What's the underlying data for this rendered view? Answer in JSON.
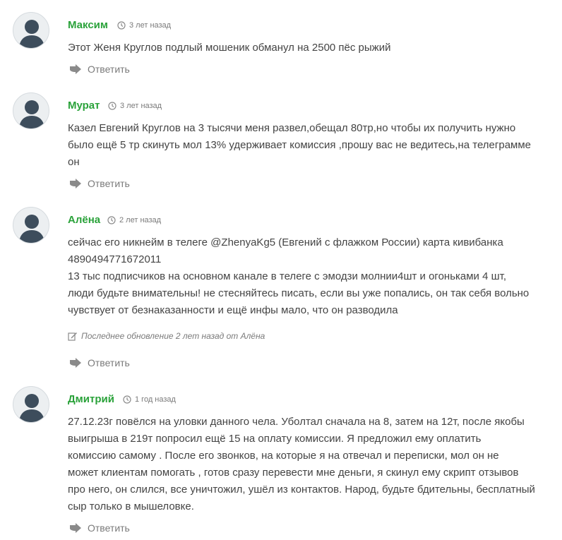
{
  "comments": [
    {
      "author": "Максим",
      "time": "3 лет назад",
      "lines": [
        "Этот Женя Круглов подлый мошеник обманул на 2500 пёс рыжий"
      ],
      "reply": "Ответить"
    },
    {
      "author": "Мурат",
      "time": "3 лет назад",
      "lines": [
        "Казел Евгений Круглов на 3 тысячи меня развел,обещал 80тр,но чтобы их получить нужно",
        "было ещё 5 тр скинуть мол 13% удерживает комиссия ,прошу вас не ведитесь,на телеграмме",
        "он"
      ],
      "reply": "Ответить"
    },
    {
      "author": "Алёна",
      "time": "2 лет назад",
      "lines": [
        "сейчас его никнейм в телеге @ZhenyaKg5 (Евгений с флажком России) карта кивибанка",
        "4890494771672011",
        "13 тыс подписчиков на основном канале в телеге с эмодзи молнии4шт и огоньками 4 шт,",
        "люди будьте внимательны! не стесняйтесь писать, если вы уже попались, он так себя вольно",
        "чувствует от безнаказанности и ещё инфы мало, что он разводила"
      ],
      "edited": "Последнее обновление 2 лет назад от Алёна",
      "reply": "Ответить"
    },
    {
      "author": "Дмитрий",
      "time": "1 год назад",
      "lines": [
        "27.12.23г повёлся на уловки данного чела. Уболтал сначала на 8, затем на 12т, после якобы",
        "выигрыша в 219т попросил ещё 15 на оплату комиссии. Я предложил ему оплатить",
        "комиссию самому . После его звонков, на которые я на отвечал и переписки, мол он не",
        "может клиентам помогать , готов сразу перевести мне деньги, я скинул ему скрипт отзывов",
        "про него, он слился, все уничтожил, ушёл из контактов. Народ, будьте бдительны, бесплатный",
        "сыр только в мышеловке."
      ],
      "reply": "Ответить"
    }
  ],
  "colors": {
    "author": "#2aa23a",
    "muted": "#7a7a7a",
    "text": "#444444"
  },
  "icons": {
    "avatar": "user-silhouette-icon",
    "time": "clock-icon",
    "edited": "edit-icon",
    "reply": "reply-arrow-icon"
  }
}
